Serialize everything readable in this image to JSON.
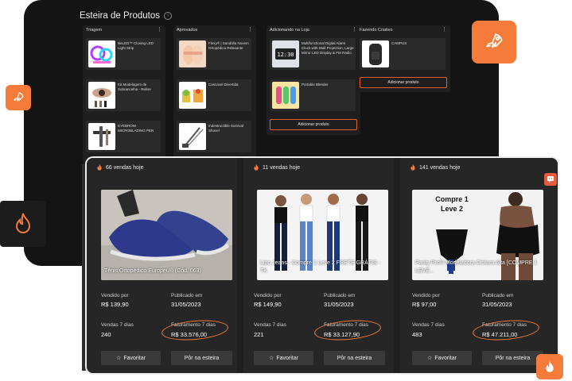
{
  "board": {
    "title": "Esteira de Produtos",
    "columns": [
      {
        "name": "Triagem",
        "cards": [
          {
            "title": "BeLED™ Closing LED Light Strip"
          },
          {
            "title": "Kit Modelagem de Sobrancelha - Relise"
          },
          {
            "title": "EYEBROW MICROBLADING PEN"
          }
        ]
      },
      {
        "name": "Aprovados",
        "cards": [
          {
            "title": "Flexy® | Sandália Nuvem Ortopédica Relaxante"
          },
          {
            "title": "Cascavel Divertida"
          },
          {
            "title": "Indestructible Survival Shovel"
          }
        ]
      },
      {
        "name": "Adicionando na Loja",
        "cards": [
          {
            "title": "Multifunctional Digital Alarm Clock with Wall Projection, Large Mirror LED Display & FM Radio"
          },
          {
            "title": "Portable Blender"
          }
        ],
        "add_label": "Adicionar produto"
      },
      {
        "name": "Fazendo Criativo",
        "cards": [
          {
            "title": "CAMPUS"
          }
        ],
        "add_label": "Adicionar produto"
      }
    ]
  },
  "icons": {
    "rocket": "rocket-icon",
    "fire": "fire-icon",
    "chat": "chat-icon",
    "star": "star-icon",
    "kebab": "kebab-icon"
  },
  "colors": {
    "accent": "#f47b3a",
    "card_bg": "#262626",
    "window_bg": "#141414"
  },
  "products": [
    {
      "sales": "66 vendas hoje",
      "name": "Tênis Ortopédico Europeu® (Cód. 063)",
      "sold_by_label": "Vendido por",
      "sold_by": "R$ 139,90",
      "published_label": "Publicado em",
      "published": "31/05/2023",
      "sales7_label": "Vendas 7 dias",
      "sales7": "240",
      "revenue_label": "Faturamento 7 dias",
      "revenue": "R$ 33.576,00",
      "favorite_label": "Favoritar",
      "belt_label": "Pôr na esteira"
    },
    {
      "sales": "11 vendas hoje",
      "name": "Lipo Jeans - Compre 1 Leve 2 FRETE GRÁTIS - TK",
      "sold_by_label": "Vendido por",
      "sold_by": "R$ 149,90",
      "published_label": "Publicado em",
      "published": "31/05/2023",
      "sales7_label": "Vendas 7 dias",
      "sales7": "221",
      "revenue_label": "Faturamento 7 dias",
      "revenue": "R$ 33.127,90",
      "favorite_label": "Favoritar",
      "belt_label": "Pôr na esteira"
    },
    {
      "sales": "141 vendas hoje",
      "name": "Panty Pro® Modeladora Cintura Alta [COMPRE 1 LEVE...",
      "image_text": "Compre 1 Leve 2",
      "sold_by_label": "Vendido por",
      "sold_by": "R$ 97,00",
      "published_label": "Publicado em",
      "published": "31/05/2023",
      "sales7_label": "Vendas 7 dias",
      "sales7": "483",
      "revenue_label": "Faturamento 7 dias",
      "revenue": "R$ 47.211,00",
      "favorite_label": "Favoritar",
      "belt_label": "Pôr na esteira"
    }
  ]
}
